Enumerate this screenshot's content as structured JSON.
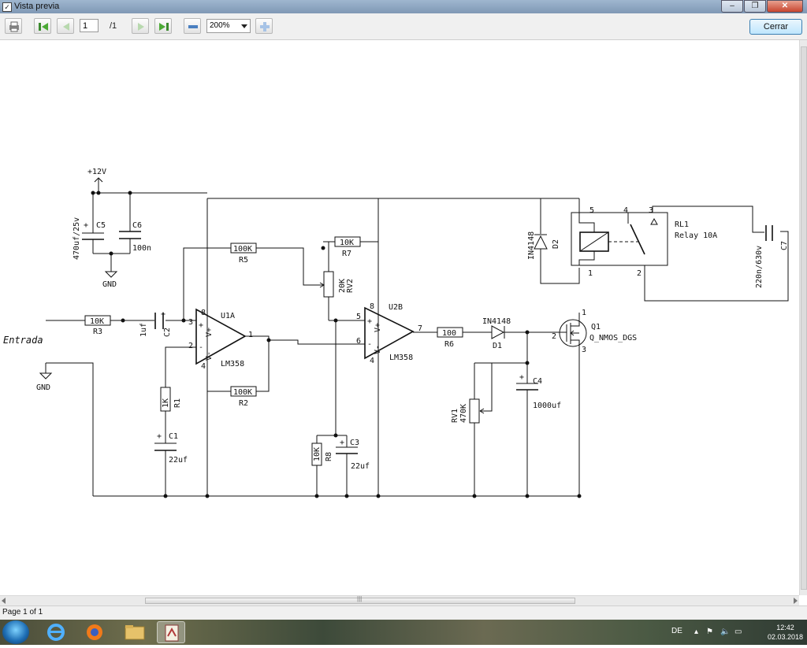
{
  "window": {
    "title": "Vista previa"
  },
  "toolbar": {
    "page_value": "1",
    "page_total": "/1",
    "zoom": "200%",
    "close_label": "Cerrar",
    "icons": [
      "print-icon",
      "first-page-icon",
      "prev-page-icon",
      "next-page-icon",
      "last-page-icon",
      "zoom-out-icon",
      "zoom-in-icon"
    ]
  },
  "schematic": {
    "supply": "+12V",
    "gnd_top": "GND",
    "gnd_input": "GND",
    "input_label": "Entrada",
    "C5": {
      "name": "C5",
      "value": "470uf/25v",
      "pol": "+"
    },
    "C6": {
      "name": "C6",
      "value": "100n"
    },
    "R3": {
      "name": "R3",
      "value": "10K"
    },
    "C2": {
      "name": "C2",
      "value": "1uf",
      "pol": "+"
    },
    "R5": {
      "name": "R5",
      "value": "100K"
    },
    "R7": {
      "name": "R7",
      "value": "10K"
    },
    "RV2": {
      "name": "RV2",
      "value": "20K"
    },
    "U1A": {
      "name": "U1A",
      "part": "LM358",
      "pin_out": "1",
      "pin_plus": "3",
      "pin_minus": "2",
      "pin_vp": "8",
      "pin_vm": "4",
      "vp": "V+",
      "vm": "V-",
      "plus": "+",
      "minus": "-"
    },
    "U2B": {
      "name": "U2B",
      "part": "LM358",
      "pin_out": "7",
      "pin_plus": "5",
      "pin_minus": "6",
      "pin_vp": "8",
      "pin_vm": "4",
      "vp": "V+",
      "vm": "V-",
      "plus": "+",
      "minus": "-"
    },
    "R1": {
      "name": "R1",
      "value": "1K"
    },
    "R2": {
      "name": "R2",
      "value": "100K"
    },
    "C1": {
      "name": "C1",
      "value": "22uf",
      "pol": "+"
    },
    "R8": {
      "name": "R8",
      "value": "10K"
    },
    "C3": {
      "name": "C3",
      "value": "22uf",
      "pol": "+"
    },
    "R6": {
      "name": "R6",
      "value": "100"
    },
    "D1": {
      "name": "D1",
      "value": "IN4148"
    },
    "D2": {
      "name": "D2",
      "value": "IN4148"
    },
    "C4": {
      "name": "C4",
      "value": "1000uf",
      "pol": "+"
    },
    "RV1": {
      "name": "RV1",
      "value": "470K"
    },
    "Q1": {
      "name": "Q1",
      "value": "Q_NMOS_DGS",
      "pin1": "1",
      "pin2": "2",
      "pin3": "3"
    },
    "RL1": {
      "name": "RL1",
      "value": "Relay 10A",
      "pin1": "1",
      "pin2": "2",
      "pin3": "3",
      "pin4": "4",
      "pin5": "5"
    },
    "C7": {
      "name": "C7",
      "value": "220n/630v"
    }
  },
  "status": {
    "text": "Page 1 of 1"
  },
  "taskbar": {
    "lang": "DE",
    "time": "12:42",
    "date": "02.03.2018"
  }
}
